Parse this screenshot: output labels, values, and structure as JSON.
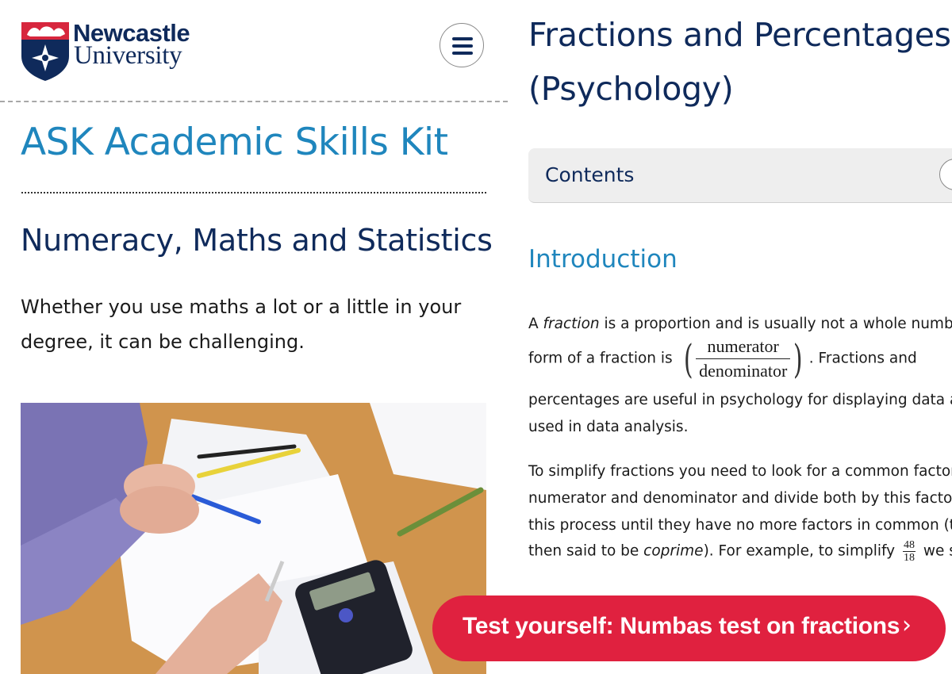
{
  "header": {
    "logo_word1": "Newcastle",
    "logo_word2": "University",
    "menu_icon": "hamburger-menu-icon"
  },
  "sidebar": {
    "site_title": "ASK Academic Skills Kit",
    "section_title": "Numeracy, Maths and Statistics",
    "lead_text": "Whether you use maths a lot or a little in your degree, it can be challenging."
  },
  "main": {
    "page_title_line1": "Fractions and Percentages",
    "page_title_line2": "(Psychology)",
    "contents_label": "Contents",
    "intro_heading": "Introduction",
    "p1": {
      "a": "A ",
      "fraction_word": "fraction",
      "b": " is a proportion and is usually not a whole number.",
      "c": "form of a fraction is ",
      "numerator": "numerator",
      "denominator": "denominator",
      "d": ". Fractions and",
      "e": "percentages are useful in psychology for displaying data and",
      "f": "used in data analysis."
    },
    "p2": {
      "line1": "To simplify fractions you need to look for a common factor o",
      "line2": "numerator and denominator and divide both by this factor. R",
      "line3": "this process until they have no more factors in common (the",
      "line4a": "then said to be ",
      "coprime": "coprime",
      "line4b": "). For example, to simplify ",
      "ex_num": "48",
      "ex_den": "18",
      "line4c": " we see"
    }
  },
  "cta": {
    "label": "Test yourself: Numbas test on fractions",
    "chevron": "›"
  },
  "colors": {
    "navy": "#0f2a5b",
    "accent_blue": "#1f86bd",
    "cta_red": "#e0213f"
  }
}
